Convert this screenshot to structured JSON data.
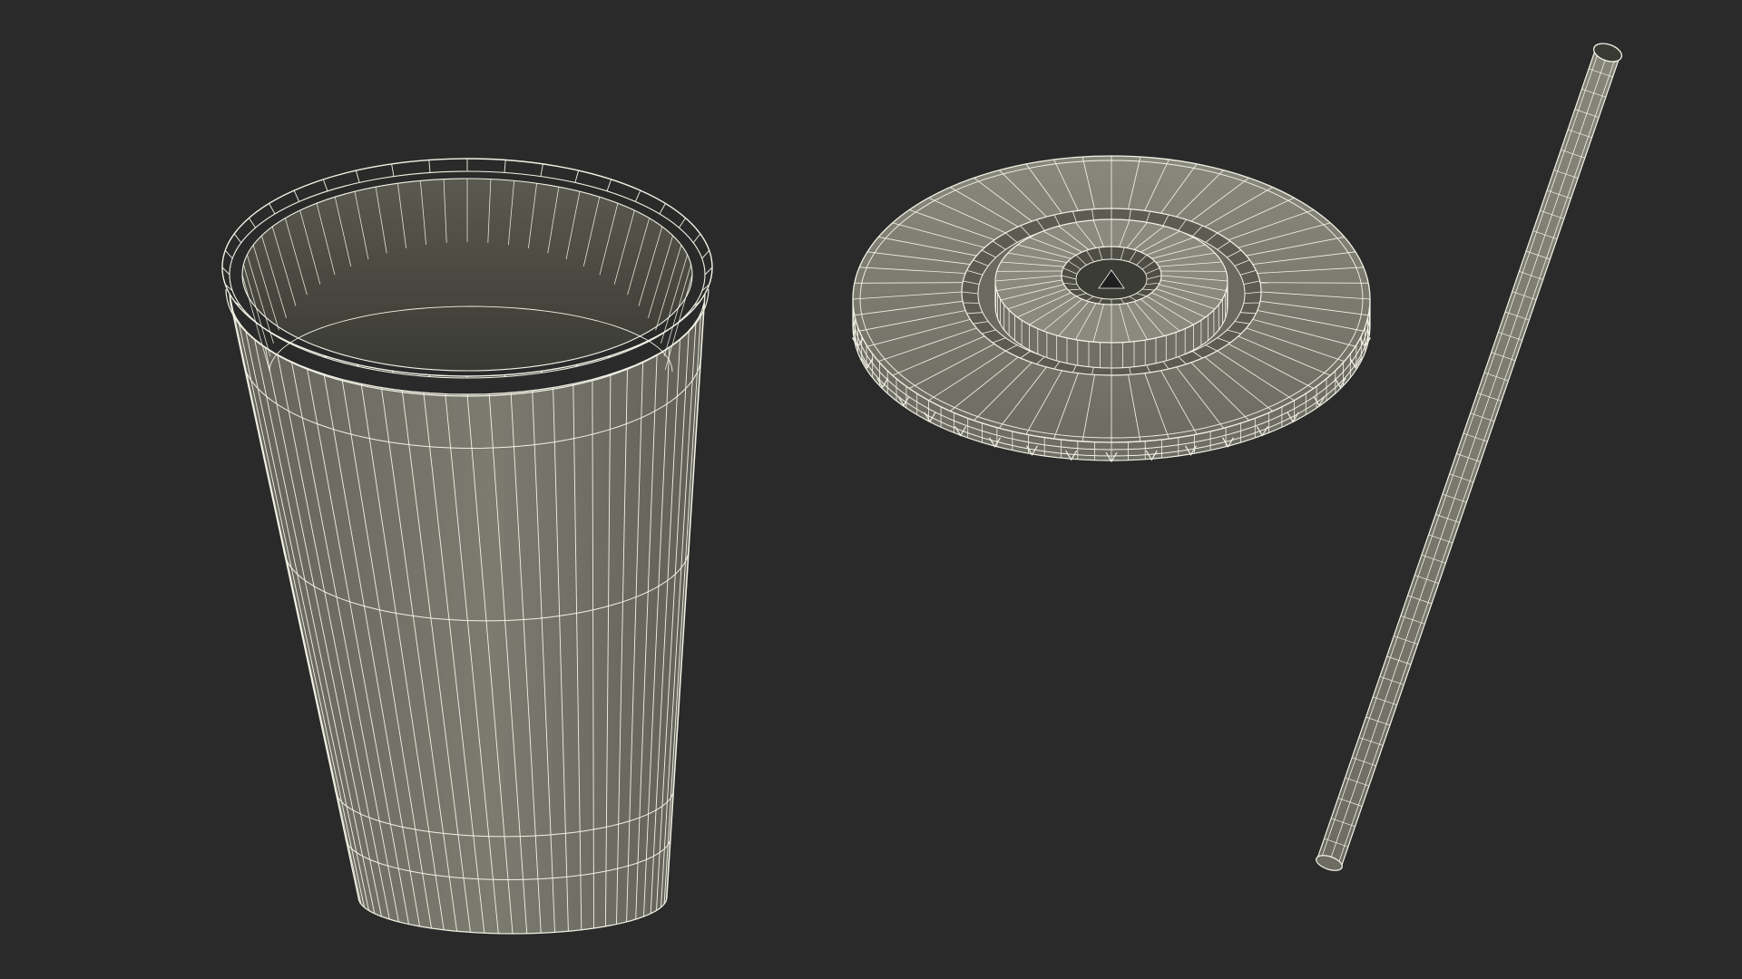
{
  "scene": {
    "objects": [
      {
        "name": "cup",
        "kind": "wireframe-model"
      },
      {
        "name": "lid",
        "kind": "wireframe-model"
      },
      {
        "name": "straw",
        "kind": "wireframe-model"
      }
    ]
  },
  "colors": {
    "background": "#2a2a2a",
    "mesh_fill_outer": "#76766c",
    "mesh_fill_inner": "#4b4b43",
    "wire": "#f2f2e6"
  }
}
